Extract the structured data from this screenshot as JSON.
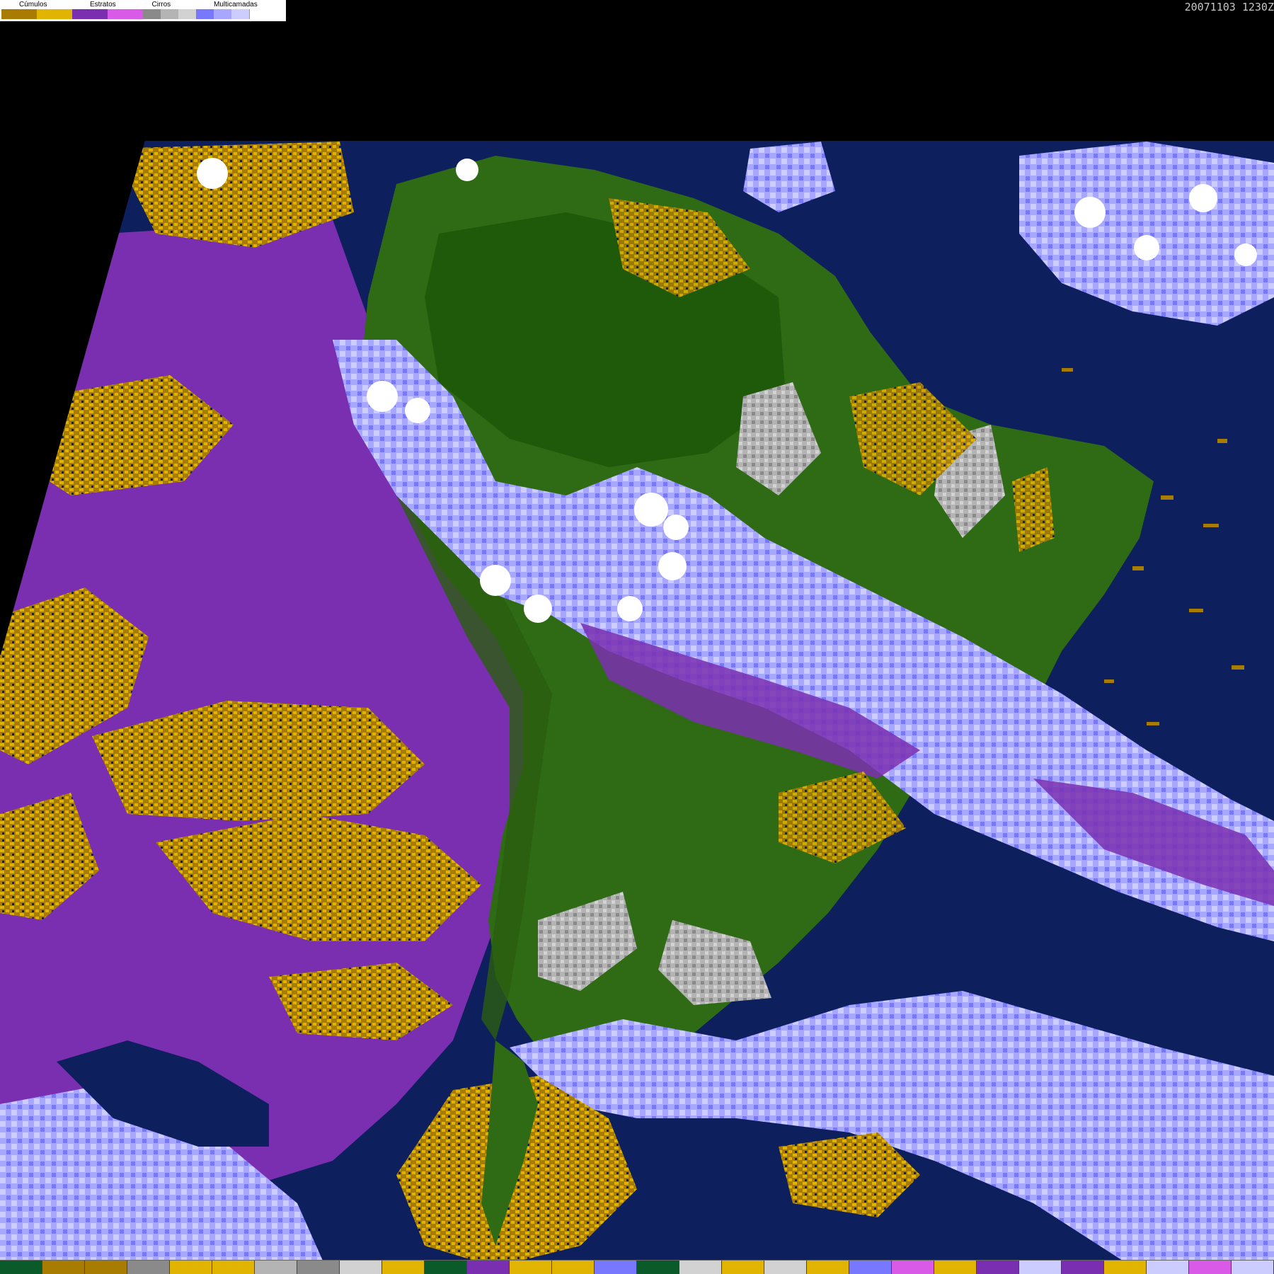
{
  "legend": {
    "groups": [
      {
        "label": "Cúmulos",
        "colors": [
          "#a87c00",
          "#e0b400"
        ]
      },
      {
        "label": "Estratos",
        "colors": [
          "#7a2fb0",
          "#d95ae6"
        ]
      },
      {
        "label": "Cirros",
        "colors": [
          "#8a8a8a",
          "#b4b4b4",
          "#d2d2d2"
        ]
      },
      {
        "label": "Multicamadas",
        "colors": [
          "#7878ff",
          "#a7a7ff",
          "#ccccff",
          "#ffffff"
        ]
      }
    ]
  },
  "timestamp": "20071103 1230Z",
  "colors": {
    "ocean": "#0d1f5c",
    "land": "#2e6b14",
    "land_dark": "#1f5a0a",
    "stratus": "#7a2fb0",
    "stratus_light": "#d95ae6",
    "cumulus_dark": "#a87c00",
    "cumulus_light": "#e0b400",
    "cirrus": "#b4b4b4",
    "multi": "#7878ff",
    "multi_light": "#ccccff",
    "white": "#ffffff"
  },
  "bottom_bar": {
    "colors": [
      "#0a5a2a",
      "#a87c00",
      "#a87c00",
      "#8a8a8a",
      "#e0b400",
      "#e0b400",
      "#b4b4b4",
      "#8a8a8a",
      "#d2d2d2",
      "#e0b400",
      "#0a5a2a",
      "#7a2fb0",
      "#e0b400",
      "#e0b400",
      "#7878ff",
      "#0a5a2a",
      "#d2d2d2",
      "#e0b400",
      "#d2d2d2",
      "#e0b400",
      "#7878ff",
      "#d95ae6",
      "#e0b400",
      "#7a2fb0",
      "#ccccff",
      "#7a2fb0",
      "#e0b400",
      "#ccccff",
      "#d95ae6",
      "#ccccff"
    ]
  }
}
